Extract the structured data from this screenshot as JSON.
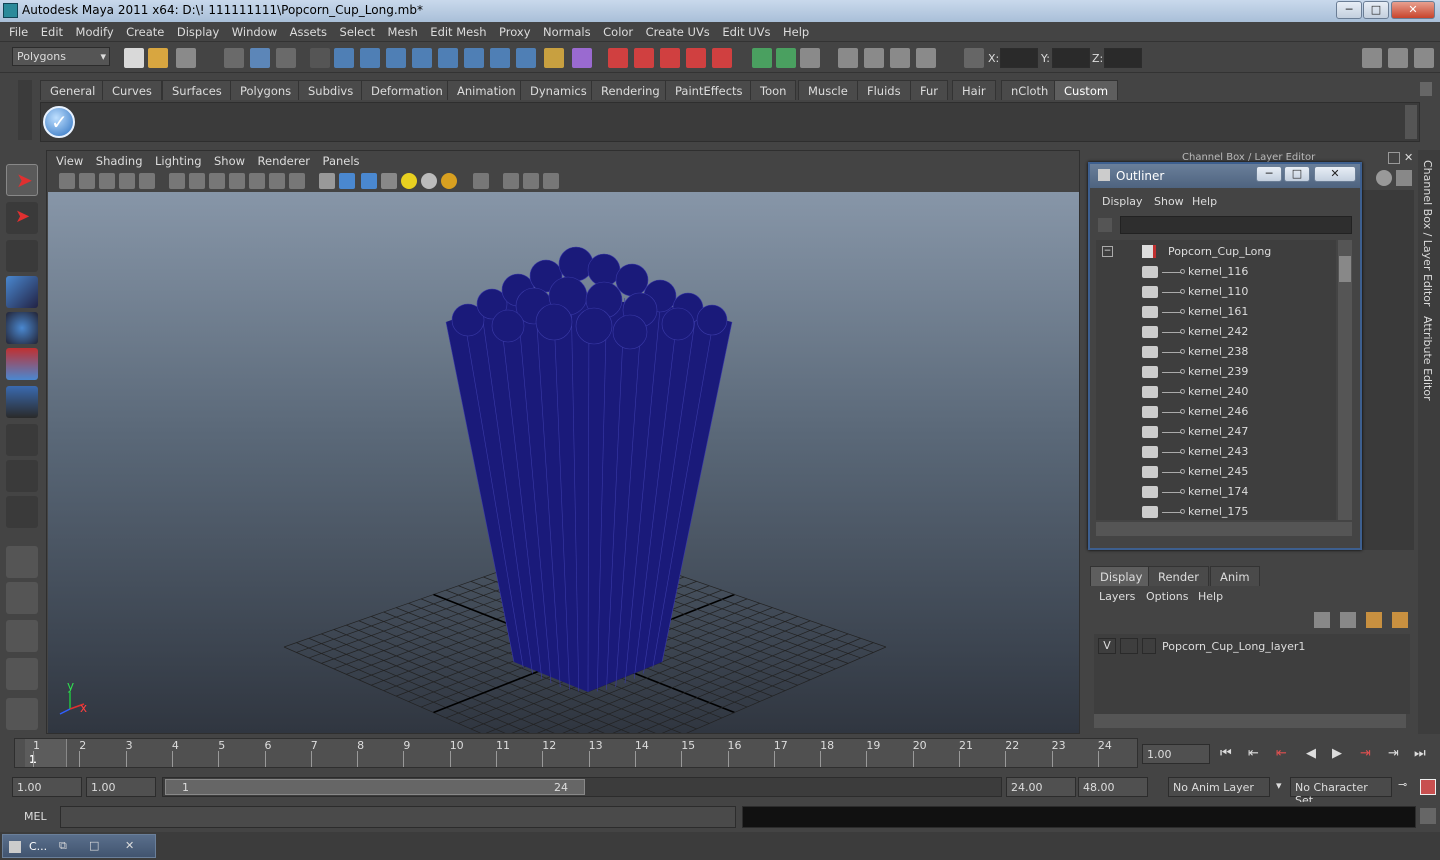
{
  "window": {
    "title": "Autodesk Maya 2011 x64: D:\\! 111111111\\Popcorn_Cup_Long.mb*",
    "min": "─",
    "max": "□",
    "close": "✕"
  },
  "menus": [
    "File",
    "Edit",
    "Modify",
    "Create",
    "Display",
    "Window",
    "Assets",
    "Select",
    "Mesh",
    "Edit Mesh",
    "Proxy",
    "Normals",
    "Color",
    "Create UVs",
    "Edit UVs",
    "Help"
  ],
  "statusline": {
    "mode": "Polygons",
    "x_label": "X:",
    "y_label": "Y:",
    "z_label": "Z:"
  },
  "shelf_tabs": [
    "General",
    "Curves",
    "Surfaces",
    "Polygons",
    "Subdivs",
    "Deformation",
    "Animation",
    "Dynamics",
    "Rendering",
    "PaintEffects",
    "Toon",
    "Muscle",
    "Fluids",
    "Fur",
    "Hair",
    "nCloth",
    "Custom"
  ],
  "shelf_active": "Custom",
  "viewport": {
    "menus": [
      "View",
      "Shading",
      "Lighting",
      "Show",
      "Renderer",
      "Panels"
    ],
    "axis_y": "y",
    "axis_x": "x",
    "mesh_color": "#1a1a7a",
    "grid_color": "#222222"
  },
  "right_panel": {
    "title": "Channel Box / Layer Editor",
    "side_tab_1": "Channel Box / Layer Editor",
    "side_tab_2": "Attribute Editor"
  },
  "outliner": {
    "title": "Outliner",
    "menus": [
      "Display",
      "Show",
      "Help"
    ],
    "root": "Popcorn_Cup_Long",
    "collapse": "−",
    "items": [
      "kernel_116",
      "kernel_110",
      "kernel_161",
      "kernel_242",
      "kernel_238",
      "kernel_239",
      "kernel_240",
      "kernel_246",
      "kernel_247",
      "kernel_243",
      "kernel_245",
      "kernel_174",
      "kernel_175"
    ]
  },
  "layer_editor": {
    "tabs": [
      "Display",
      "Render",
      "Anim"
    ],
    "active_tab": "Display",
    "menus": [
      "Layers",
      "Options",
      "Help"
    ],
    "layer_visibility": "V",
    "layer_name": "Popcorn_Cup_Long_layer1"
  },
  "timeline": {
    "ticks": [
      "1",
      "2",
      "3",
      "4",
      "5",
      "6",
      "7",
      "8",
      "9",
      "10",
      "11",
      "12",
      "13",
      "14",
      "15",
      "16",
      "17",
      "18",
      "19",
      "20",
      "21",
      "22",
      "23",
      "24"
    ],
    "current_frame_marker": "1",
    "current_time": "1.00"
  },
  "range": {
    "start": "1.00",
    "playback_start": "1.00",
    "slider_start": "1",
    "slider_end": "24",
    "playback_end": "24.00",
    "end": "48.00",
    "anim_layer": "No Anim Layer",
    "character_set": "No Character Set"
  },
  "command": {
    "label": "MEL"
  },
  "taskbar": {
    "label": "C..."
  }
}
